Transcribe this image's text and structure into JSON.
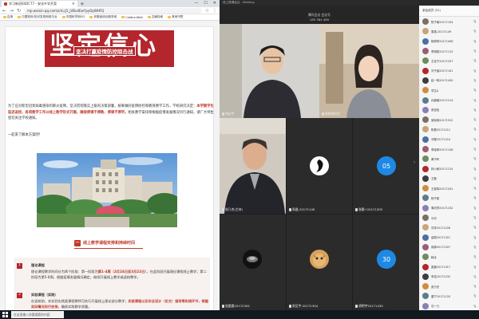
{
  "browser": {
    "tab_title": "学习新冠SSDC77 - 安化乡学开案",
    "url": "mp.weixin.qq.com/s/rLcJ1_jVBu4EwYpyOpWHFQ",
    "bookmarks": [
      "应用",
      "中国知网-知识发现网络平台",
      "中国科学网SCI",
      "安徽省综合服务网",
      "Calibre-Web",
      "文献检索",
      "其他书签"
    ]
  },
  "article": {
    "banner_big": "坚定信心",
    "banner_sub": "坚决打赢疫情防控阻击战",
    "intro_a": "为了应对新型冠状病毒感染的肺炎疫情，坚决贯彻落实上级的决策部署，统筹做好疫情防控和教育教学工作，学校研究决定：",
    "intro_red": "本学期学生延迟返校，各项教学工作以线上教学形式开展，确保停课不停教、停课不停学。",
    "intro_b": "相关教学安排将根据疫情发展情况另行通知，请广大师生密切关注学校通知。",
    "intro_more": "一起来了解本方案吧！",
    "section_num": "一",
    "section_title": "线上教学课程安排和持续时间",
    "items": [
      {
        "num": "1",
        "heading": "理论课程",
        "text_a": "理论课程教学时间分为两个阶段：第一阶段为",
        "text_red": "第1-4周（2月24日至3月22日）",
        "text_b": "，在此阶段开展理论课程线上教学；第二阶段为第5-8周，根据疫情发展情况确定，继续开展线上教学或返校教学。"
      },
      {
        "num": "2",
        "heading": "实验课程（实践）",
        "text_a": "在返校前，非实验实践类课程教师可先行开展线上理论部分教学；",
        "text_red": "实验课程以及毕业设计（论文）指导等实践环节，根据实际情况另行安排，",
        "text_b": "确保实践教学质量。"
      }
    ]
  },
  "taskbar": {
    "search_placeholder": "在这里输入你要搜索的内容"
  },
  "meeting": {
    "window_title": "线上授课会议 - Meeting",
    "header_line1": "腾讯会议 会议号",
    "header_line2": "185 384 489",
    "tiles": [
      {
        "label": "刘纪宇",
        "kind": "video"
      },
      {
        "label": "杨婷婷同学",
        "kind": "video"
      },
      {
        "label": "张乃杰(主持)",
        "kind": "video"
      },
      {
        "label": "周逸-20171149",
        "kind": "avatar"
      },
      {
        "label": "张静+20171305",
        "kind": "number",
        "badge": "05"
      },
      {
        "label": "张晨晨20172305",
        "kind": "avatar"
      },
      {
        "label": "周至宇-20171304",
        "kind": "avatar"
      },
      {
        "label": "胡明宇20171430",
        "kind": "number",
        "badge": "30"
      }
    ],
    "participants_header": "参会成员 (31)",
    "participants": [
      "陈子瑜20171104",
      "周逸-20171149",
      "杨婷婷20171406",
      "李明阳20171113",
      "王佳宁20171207",
      "刘子涵20171101",
      "赵一鸣20171430",
      "学生A",
      "孙晨曦20171214",
      "张佳怡",
      "吴晓雨20171522",
      "陈昊20171211",
      "冯雪20171210",
      "李晓菲20171128",
      "黄子轩",
      "林小雨20171215",
      "王磊",
      "王俊辉20171431",
      "杨子豪",
      "周欣然20171232",
      "马可",
      "刘洋20171226",
      "高原20171321",
      "胡静20171507",
      "韩冰",
      "梁晨20171317",
      "宋佳20171232",
      "张乃杰",
      "唐宁20171120",
      "沈一凡"
    ],
    "colors": {
      "accent": "#b3262c",
      "badge_blue": "#1e88e5"
    }
  }
}
